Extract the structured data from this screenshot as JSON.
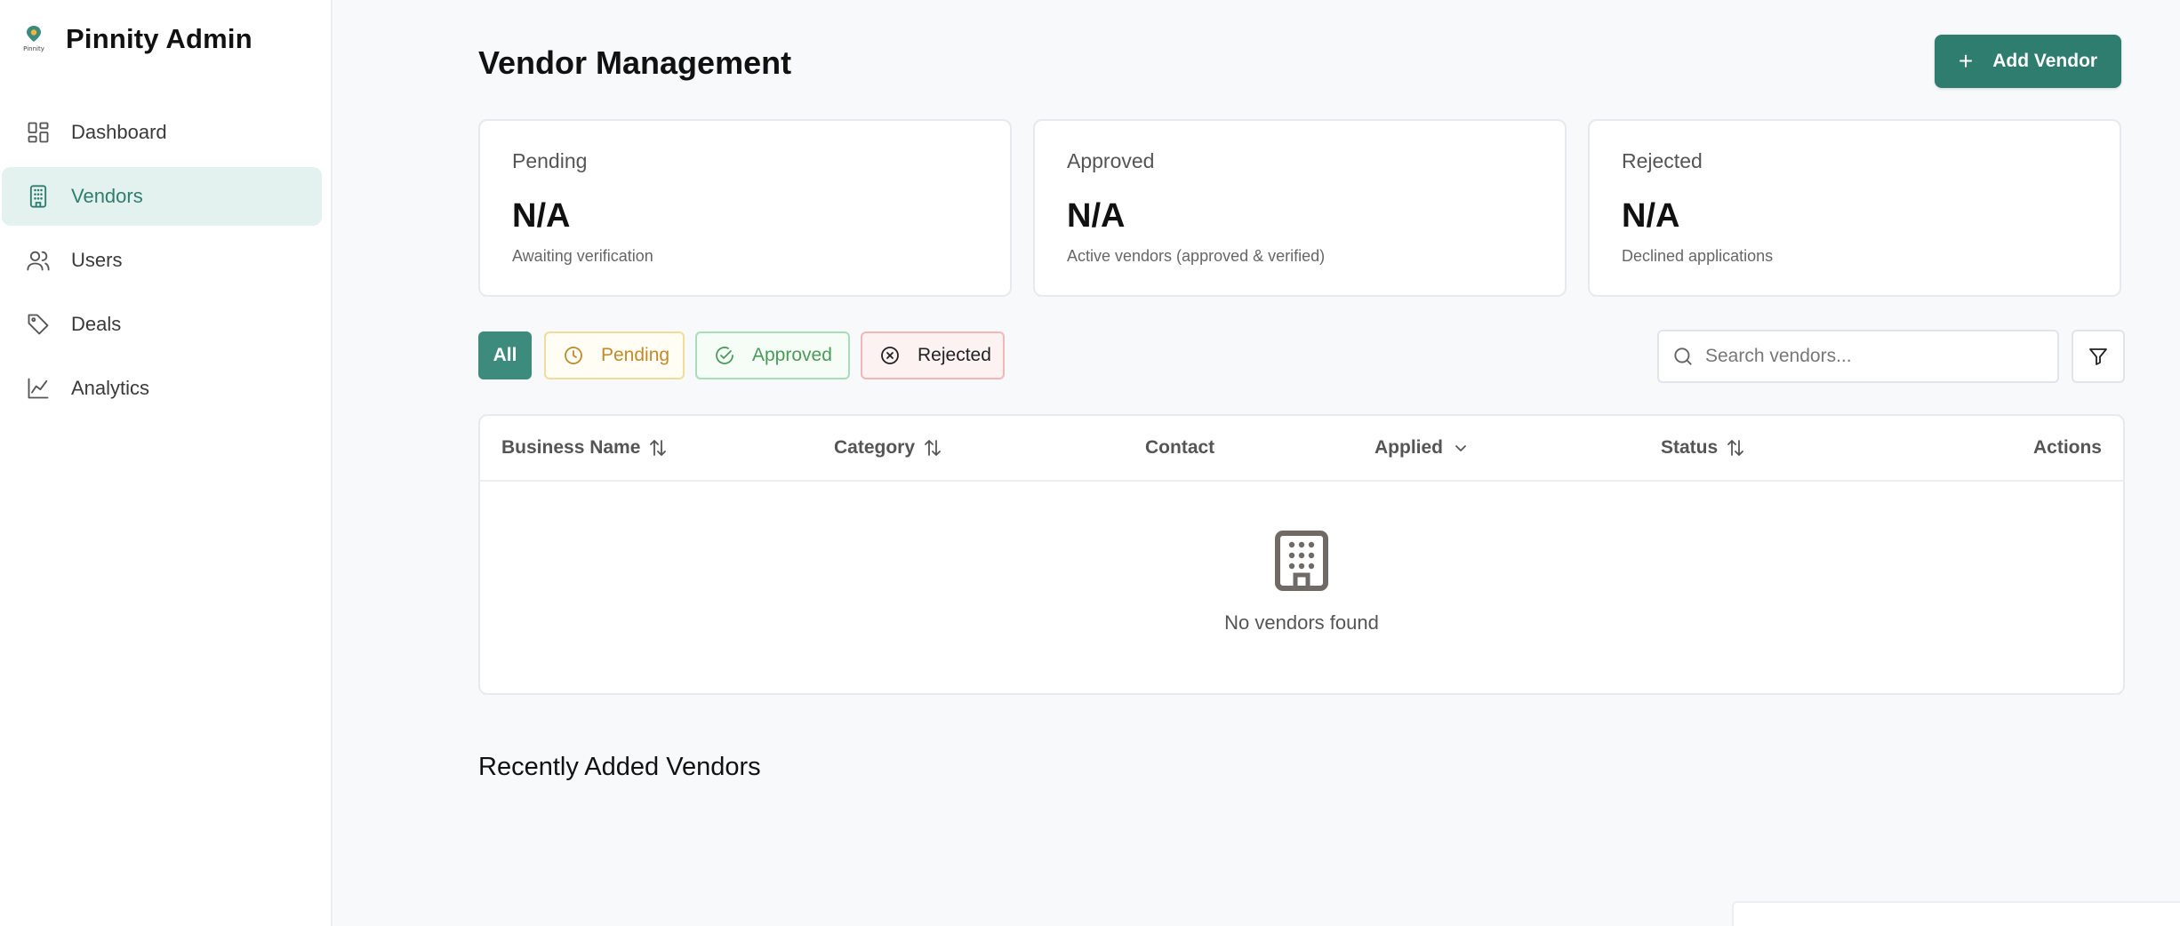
{
  "sidebar": {
    "brand_title": "Pinnity Admin",
    "logo_text": "Pinnity",
    "items": [
      {
        "label": "Dashboard",
        "icon": "dashboard-icon",
        "active": false
      },
      {
        "label": "Vendors",
        "icon": "building-icon",
        "active": true
      },
      {
        "label": "Users",
        "icon": "users-icon",
        "active": false
      },
      {
        "label": "Deals",
        "icon": "tag-icon",
        "active": false
      },
      {
        "label": "Analytics",
        "icon": "chart-line-icon",
        "active": false
      }
    ]
  },
  "header": {
    "title": "Vendor Management",
    "add_button_label": "Add Vendor"
  },
  "stats": [
    {
      "label": "Pending",
      "value": "N/A",
      "sub": "Awaiting verification"
    },
    {
      "label": "Approved",
      "value": "N/A",
      "sub": "Active vendors (approved & verified)"
    },
    {
      "label": "Rejected",
      "value": "N/A",
      "sub": "Declined applications"
    }
  ],
  "filters": {
    "all": "All",
    "pending": "Pending",
    "approved": "Approved",
    "rejected": "Rejected",
    "selected": "All"
  },
  "search": {
    "placeholder": "Search vendors...",
    "value": ""
  },
  "table": {
    "columns": [
      {
        "label": "Business Name",
        "sort": "both"
      },
      {
        "label": "Category",
        "sort": "both"
      },
      {
        "label": "Contact",
        "sort": "none"
      },
      {
        "label": "Applied",
        "sort": "desc"
      },
      {
        "label": "Status",
        "sort": "both"
      },
      {
        "label": "Actions",
        "sort": "none"
      }
    ],
    "rows": [],
    "empty_text": "No vendors found"
  },
  "recent": {
    "title": "Recently Added Vendors"
  },
  "colors": {
    "accent": "#2f7d6f",
    "active_nav_bg": "#e3f1ef",
    "pending": "#c08a2a",
    "approved": "#4a9a59",
    "rejected_border": "#f1b7b7"
  }
}
